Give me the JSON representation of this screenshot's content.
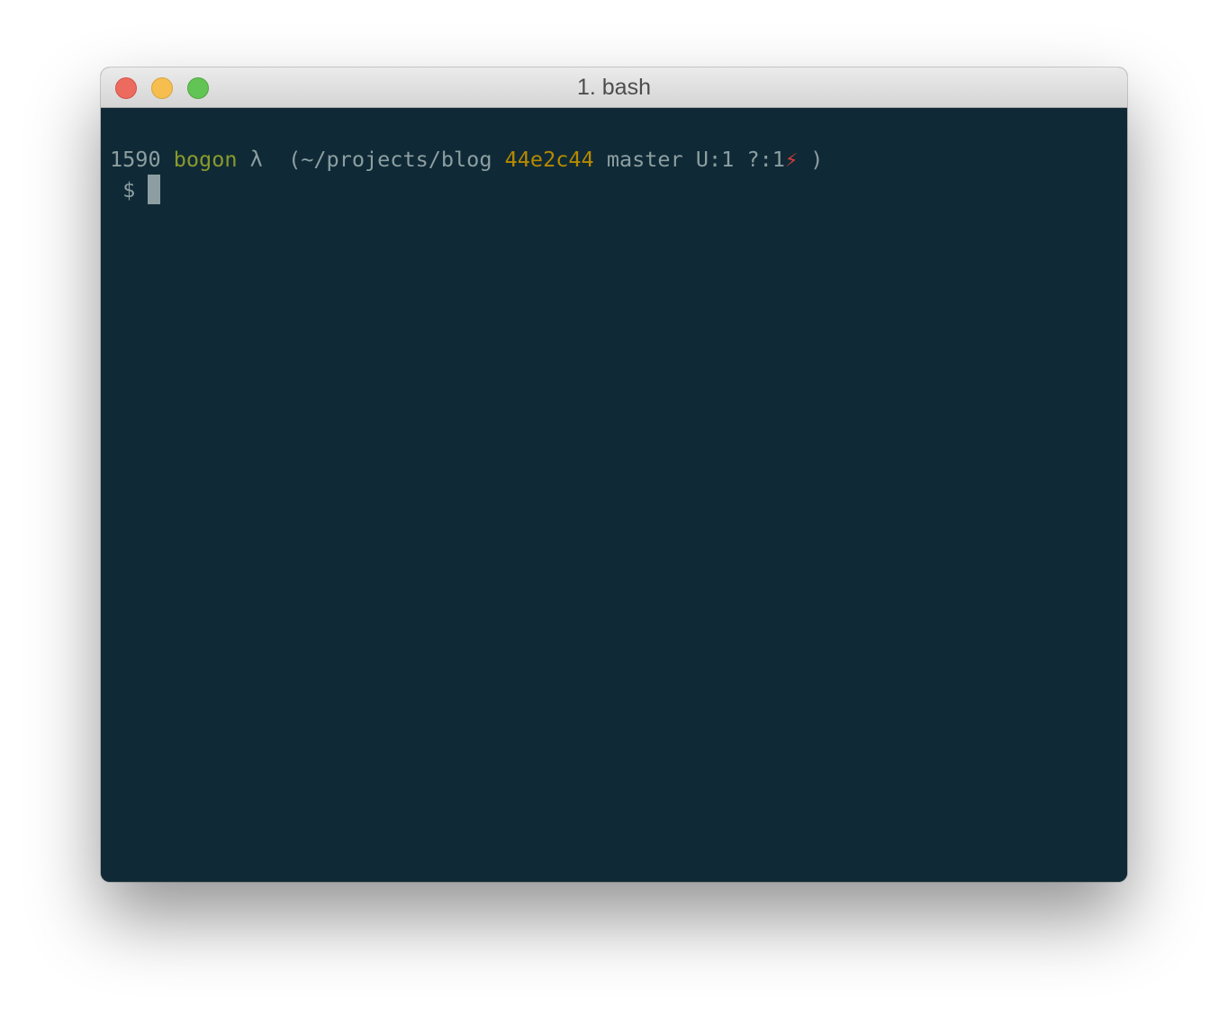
{
  "window": {
    "title": "1. bash"
  },
  "terminal": {
    "prompt_line": {
      "history_number": "1590",
      "host": "bogon",
      "lambda": "λ",
      "path_open": "(~/projects/blog",
      "commit_hash": "44e2c44",
      "branch": "master",
      "unstaged": "U:1",
      "untracked": "?:1",
      "dirty_symbol": "⚡",
      "close_paren": ")"
    },
    "input_line": {
      "prompt_symbol": "$",
      "command": ""
    }
  },
  "colors": {
    "background": "#0f2a36",
    "text": "#8d9ea1",
    "host": "#8a9a2b",
    "hash": "#b58900",
    "dirty": "#d23b3b",
    "close_button": "#ed6a5e",
    "minimize_button": "#f6be4f",
    "zoom_button": "#61c454"
  }
}
